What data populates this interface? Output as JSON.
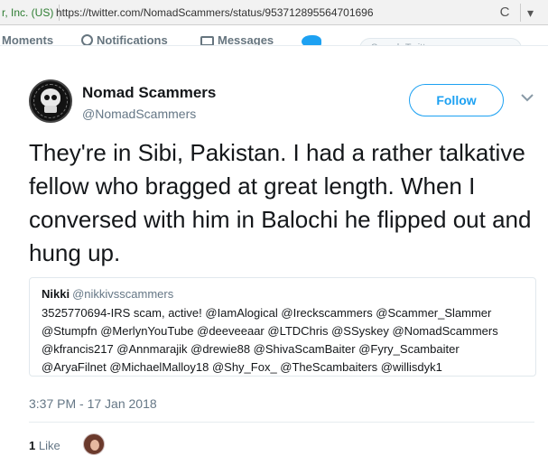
{
  "browser": {
    "site_identity": "r, Inc. (US)",
    "url": "https://twitter.com/NomadScammers/status/953712895564701696",
    "reload_icon": "reload-icon",
    "reload_glyph": "C",
    "overflow_icon": "chevron-down-icon",
    "overflow_glyph": "▾"
  },
  "twitter_nav": {
    "moments": "Moments",
    "notifications": "Notifications",
    "messages": "Messages",
    "search_placeholder": "Search Twitter",
    "brand_color": "#1da1f2"
  },
  "tweet": {
    "display_name": "Nomad Scammers",
    "handle": "@NomadScammers",
    "follow_label": "Follow",
    "text": "They're in Sibi, Pakistan. I had a rather talkative fellow who bragged at great length. When I conversed with him in Balochi he flipped out and hung up.",
    "timestamp": "3:37 PM - 17 Jan 2018",
    "like_count": "1",
    "like_label": "Like",
    "accent_color": "#1da1f2"
  },
  "quoted_tweet": {
    "name": "Nikki",
    "handle": "@nikkivsscammers",
    "text": "3525770694-IRS scam, active! @IamAlogical @Ireckscammers @Scammer_Slammer @Stumpfn @MerlynYouTube @deeveeaar @LTDChris @SSyskey @NomadScammers @kfrancis217 @Annmarajik @drewie88 @ShivaScamBaiter @Fyry_Scambaiter @AryaFilnet @MichaelMalloy18 @Shy_Fox_ @TheScambaiters @willisdyk1"
  }
}
